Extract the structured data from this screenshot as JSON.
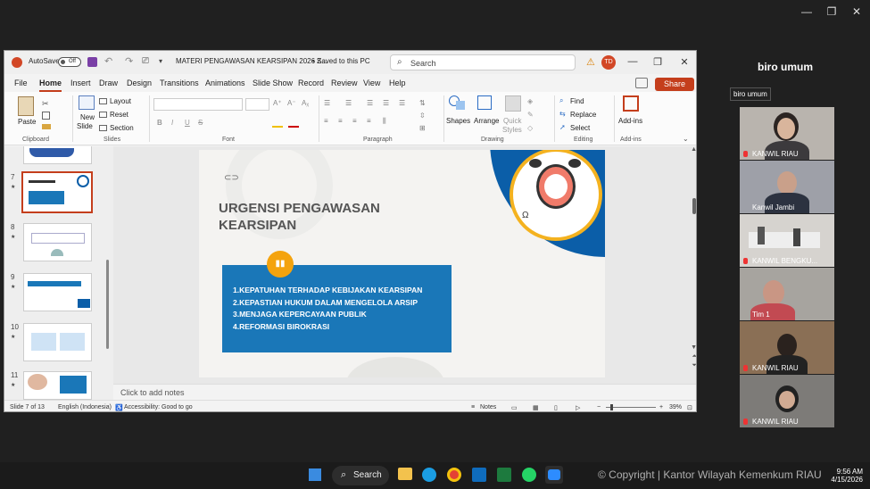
{
  "zoom_host": {
    "presenter_label": "biro umum",
    "tooltip": "biro umum",
    "window_controls": [
      "—",
      "❐",
      "✕"
    ]
  },
  "ppt": {
    "titlebar": {
      "autosave": "AutoSave",
      "autosave_state": "Off",
      "filename": "MATERI PENGAWASAN KEARSIPAN 2026 Z...",
      "saved": "• Saved to this PC",
      "search_placeholder": "Search",
      "user_initials": "TD"
    },
    "menu": [
      "File",
      "Home",
      "Insert",
      "Draw",
      "Design",
      "Transitions",
      "Animations",
      "Slide Show",
      "Record",
      "Review",
      "View",
      "Help"
    ],
    "share": "Share",
    "ribbon": {
      "clipboard": {
        "paste": "Paste",
        "group": "Clipboard"
      },
      "slides": {
        "new_slide": "New",
        "new_slide2": "Slide",
        "layout": "Layout",
        "reset": "Reset",
        "section": "Section",
        "group": "Slides"
      },
      "font": {
        "group": "Font",
        "bold": "B",
        "italic": "I",
        "underline": "U",
        "strike": "S"
      },
      "paragraph": {
        "group": "Paragraph"
      },
      "drawing": {
        "shapes": "Shapes",
        "arrange": "Arrange",
        "quick": "Quick",
        "styles": "Styles",
        "group": "Drawing"
      },
      "editing": {
        "find": "Find",
        "replace": "Replace",
        "select": "Select",
        "group": "Editing"
      },
      "addins": {
        "label1": "Add-ins",
        "group": "Add-ins"
      }
    },
    "thumbnails": [
      {
        "num": "7",
        "star": "★"
      },
      {
        "num": "8",
        "star": "★"
      },
      {
        "num": "9",
        "star": "★"
      },
      {
        "num": "10",
        "star": "★"
      },
      {
        "num": "11",
        "star": "★"
      }
    ],
    "slide": {
      "title_line1": "URGENSI PENGAWASAN",
      "title_line2": "KEARSIPAN",
      "items": [
        "1.KEPATUHAN TERHADAP KEBIJAKAN KEARSIPAN",
        "2.KEPASTIAN HUKUM DALAM MENGELOLA ARSIP",
        "3.MENJAGA KEPERCAYAAN PUBLIK",
        "4.REFORMASI BIROKRASI"
      ]
    },
    "notes_placeholder": "Click to add notes",
    "status": {
      "slide_of": "Slide 7 of 13",
      "language": "English (Indonesia)",
      "accessibility": "Accessibility: Good to go",
      "notes": "Notes",
      "zoom": "39%"
    }
  },
  "participants": [
    {
      "name": "KANWIL RIAU",
      "muted": true
    },
    {
      "name": "Kanwil Jambi",
      "muted": false
    },
    {
      "name": "KANWIL BENGKU...",
      "muted": true
    },
    {
      "name": "Tim 1",
      "muted": false
    },
    {
      "name": "KANWIL RIAU",
      "muted": true
    },
    {
      "name": "KANWIL RIAU",
      "muted": true
    }
  ],
  "taskbar": {
    "search": "Search",
    "watermark": "© Copyright | Kantor Wilayah Kemenkum RIAU",
    "time": "9:56 AM",
    "date": "4/15/2026"
  },
  "colors": {
    "accent_red": "#c43e1c",
    "slide_blue": "#1a77b8",
    "slide_orange": "#f4a30e",
    "slide_navy": "#0b5ea8"
  }
}
